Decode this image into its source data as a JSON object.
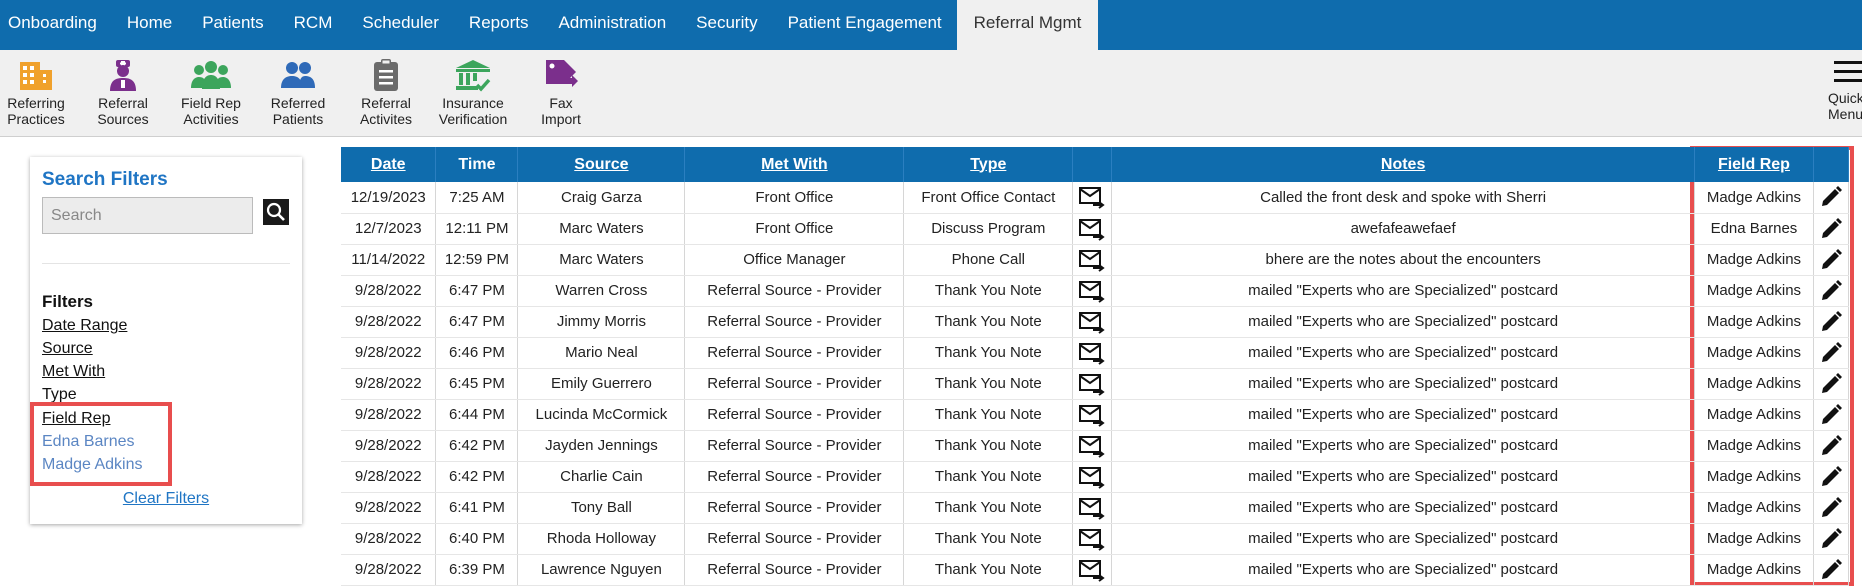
{
  "nav": {
    "items": [
      "Onboarding",
      "Home",
      "Patients",
      "RCM",
      "Scheduler",
      "Reports",
      "Administration",
      "Security",
      "Patient Engagement",
      "Referral Mgmt"
    ],
    "active": "Referral Mgmt"
  },
  "toolbar": {
    "tools": [
      {
        "line1": "Referring",
        "line2": "Practices",
        "icon": "building-icon",
        "color": "#f0a12c"
      },
      {
        "line1": "Referral",
        "line2": "Sources",
        "icon": "doctor-icon",
        "color": "#7b2f8c"
      },
      {
        "line1": "Field Rep",
        "line2": "Activities",
        "icon": "group-icon",
        "color": "#3ca55c"
      },
      {
        "line1": "Referred",
        "line2": "Patients",
        "icon": "users-icon",
        "color": "#2f6ab8"
      },
      {
        "line1": "Referral",
        "line2": "Activites",
        "icon": "clipboard-icon",
        "color": "#6b6b6b"
      },
      {
        "line1": "Insurance",
        "line2": "Verification",
        "icon": "bank-check-icon",
        "color": "#3ca55c"
      },
      {
        "line1": "Fax",
        "line2": "Import",
        "icon": "fax-tag-icon",
        "color": "#7b2f8c"
      }
    ],
    "quick_menu": {
      "line1": "Quick",
      "line2": "Menu"
    }
  },
  "filters": {
    "title": "Search Filters",
    "search_placeholder": "Search",
    "heading": "Filters",
    "links": [
      "Date Range",
      "Source",
      "Met With"
    ],
    "type_label": "Type",
    "field_rep_link": "Field Rep",
    "field_rep_values": [
      "Edna Barnes",
      "Madge Adkins"
    ],
    "clear": "Clear Filters"
  },
  "table": {
    "headers": {
      "date": "Date",
      "time": "Time",
      "source": "Source",
      "met_with": "Met With",
      "type": "Type",
      "notes": "Notes",
      "field_rep": "Field Rep"
    },
    "rows": [
      {
        "date": "12/19/2023",
        "time": "7:25 AM",
        "source": "Craig Garza",
        "met_with": "Front Office",
        "type": "Front Office Contact",
        "notes": "Called the front desk and spoke with Sherri",
        "field_rep": "Madge Adkins"
      },
      {
        "date": "12/7/2023",
        "time": "12:11 PM",
        "source": "Marc Waters",
        "met_with": "Front Office",
        "type": "Discuss Program",
        "notes": "awefafeawefaef",
        "field_rep": "Edna Barnes"
      },
      {
        "date": "11/14/2022",
        "time": "12:59 PM",
        "source": "Marc Waters",
        "met_with": "Office Manager",
        "type": "Phone Call",
        "notes": "bhere are the notes about the encounters",
        "field_rep": "Madge Adkins"
      },
      {
        "date": "9/28/2022",
        "time": "6:47 PM",
        "source": "Warren Cross",
        "met_with": "Referral Source - Provider",
        "type": "Thank You Note",
        "notes": "mailed \"Experts who are Specialized\" postcard",
        "field_rep": "Madge Adkins"
      },
      {
        "date": "9/28/2022",
        "time": "6:47 PM",
        "source": "Jimmy Morris",
        "met_with": "Referral Source - Provider",
        "type": "Thank You Note",
        "notes": "mailed \"Experts who are Specialized\" postcard",
        "field_rep": "Madge Adkins"
      },
      {
        "date": "9/28/2022",
        "time": "6:46 PM",
        "source": "Mario Neal",
        "met_with": "Referral Source - Provider",
        "type": "Thank You Note",
        "notes": "mailed \"Experts who are Specialized\" postcard",
        "field_rep": "Madge Adkins"
      },
      {
        "date": "9/28/2022",
        "time": "6:45 PM",
        "source": "Emily Guerrero",
        "met_with": "Referral Source - Provider",
        "type": "Thank You Note",
        "notes": "mailed \"Experts who are Specialized\" postcard",
        "field_rep": "Madge Adkins"
      },
      {
        "date": "9/28/2022",
        "time": "6:44 PM",
        "source": "Lucinda McCormick",
        "met_with": "Referral Source - Provider",
        "type": "Thank You Note",
        "notes": "mailed \"Experts who are Specialized\" postcard",
        "field_rep": "Madge Adkins"
      },
      {
        "date": "9/28/2022",
        "time": "6:42 PM",
        "source": "Jayden Jennings",
        "met_with": "Referral Source - Provider",
        "type": "Thank You Note",
        "notes": "mailed \"Experts who are Specialized\" postcard",
        "field_rep": "Madge Adkins"
      },
      {
        "date": "9/28/2022",
        "time": "6:42 PM",
        "source": "Charlie Cain",
        "met_with": "Referral Source - Provider",
        "type": "Thank You Note",
        "notes": "mailed \"Experts who are Specialized\" postcard",
        "field_rep": "Madge Adkins"
      },
      {
        "date": "9/28/2022",
        "time": "6:41 PM",
        "source": "Tony Ball",
        "met_with": "Referral Source - Provider",
        "type": "Thank You Note",
        "notes": "mailed \"Experts who are Specialized\" postcard",
        "field_rep": "Madge Adkins"
      },
      {
        "date": "9/28/2022",
        "time": "6:40 PM",
        "source": "Rhoda Holloway",
        "met_with": "Referral Source - Provider",
        "type": "Thank You Note",
        "notes": "mailed \"Experts who are Specialized\" postcard",
        "field_rep": "Madge Adkins"
      },
      {
        "date": "9/28/2022",
        "time": "6:39 PM",
        "source": "Lawrence Nguyen",
        "met_with": "Referral Source - Provider",
        "type": "Thank You Note",
        "notes": "mailed \"Experts who are Specialized\" postcard",
        "field_rep": "Madge Adkins"
      }
    ],
    "row_icons": {
      "mail": "mail-send-icon",
      "edit": "pencil-icon"
    }
  },
  "colors": {
    "nav_bg": "#0f6cad",
    "header_bg": "#0f6cad",
    "highlight_border": "#e84e4e",
    "link_blue": "#1f75c4",
    "filter_value": "#5b86c3"
  }
}
